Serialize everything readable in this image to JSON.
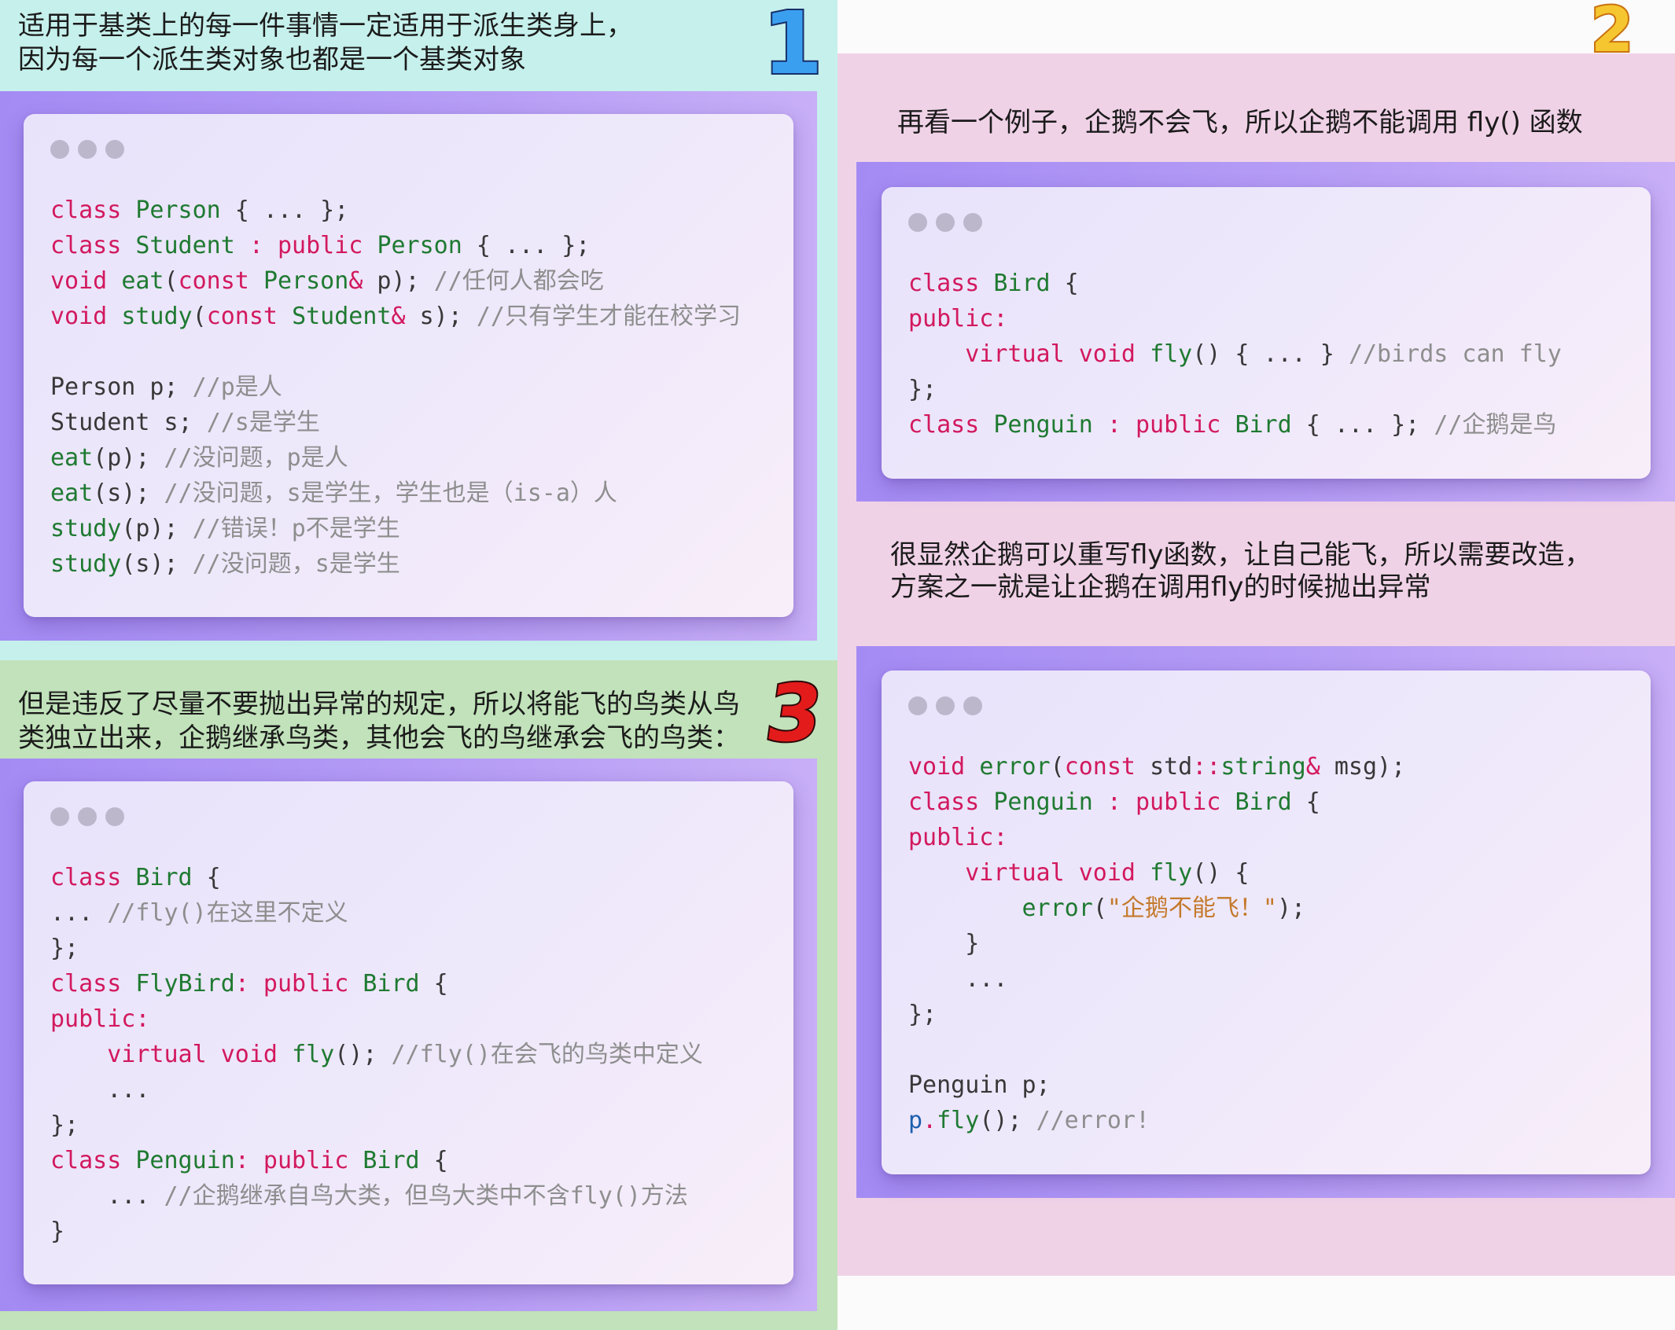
{
  "section_1": {
    "badge": "1",
    "caption": [
      "适用于基类上的每一件事情一定适用于派生类身上，",
      "因为每一个派生类对象也都是一个基类对象"
    ]
  },
  "section_2": {
    "badge": "2",
    "caption_top": "再看一个例子，企鹅不会飞，所以企鹅不能调用 fly() 函数",
    "caption_middle": [
      "很显然企鹅可以重写fly函数，让自己能飞，所以需要改造，",
      "方案之一就是让企鹅在调用fly的时候抛出异常"
    ]
  },
  "section_3": {
    "badge": "3",
    "caption": [
      "但是违反了尽量不要抛出异常的规定，所以将能飞的鸟类从鸟",
      "类独立出来，企鹅继承鸟类，其他会飞的鸟继承会飞的鸟类："
    ]
  },
  "colors": {
    "section_1_bg": "#c6f0ec",
    "section_2_bg": "#f0d2e7",
    "section_3_bg": "#c1e2ba",
    "outer_bg": "#fbfbfb",
    "stage_gradient": [
      "#a48bf4",
      "#c8aff7"
    ],
    "window_dot": "#bdb7cc"
  },
  "code_blocks": [
    {
      "lines": [
        [
          [
            "class ",
            "#d2195e"
          ],
          [
            "Person",
            "#1f7a31"
          ],
          [
            " { ... };",
            "#383838"
          ]
        ],
        [
          [
            "class ",
            "#d2195e"
          ],
          [
            "Student",
            "#1f7a31"
          ],
          [
            " : public ",
            "#d2195e"
          ],
          [
            "Person",
            "#1f7a31"
          ],
          [
            " { ... };",
            "#383838"
          ]
        ],
        [
          [
            "void ",
            "#d2195e"
          ],
          [
            "eat",
            "#1f7a31"
          ],
          [
            "(",
            "#383838"
          ],
          [
            "const ",
            "#d2195e"
          ],
          [
            "Person",
            "#1f7a31"
          ],
          [
            "&",
            "#d2195e"
          ],
          [
            " p); ",
            "#383838"
          ],
          [
            "//任何人都会吃",
            "#8e8e8e"
          ]
        ],
        [
          [
            "void ",
            "#d2195e"
          ],
          [
            "study",
            "#1f7a31"
          ],
          [
            "(",
            "#383838"
          ],
          [
            "const ",
            "#d2195e"
          ],
          [
            "Student",
            "#1f7a31"
          ],
          [
            "&",
            "#d2195e"
          ],
          [
            " s); ",
            "#383838"
          ],
          [
            "//只有学生才能在校学习",
            "#8e8e8e"
          ]
        ],
        [],
        [
          [
            "Person p; ",
            "#383838"
          ],
          [
            "//p是人",
            "#8e8e8e"
          ]
        ],
        [
          [
            "Student s; ",
            "#383838"
          ],
          [
            "//s是学生",
            "#8e8e8e"
          ]
        ],
        [
          [
            "eat",
            "#1f7a31"
          ],
          [
            "(p); ",
            "#383838"
          ],
          [
            "//没问题，p是人",
            "#8e8e8e"
          ]
        ],
        [
          [
            "eat",
            "#1f7a31"
          ],
          [
            "(s); ",
            "#383838"
          ],
          [
            "//没问题，s是学生，学生也是（is-a）人",
            "#8e8e8e"
          ]
        ],
        [
          [
            "study",
            "#1f7a31"
          ],
          [
            "(p); ",
            "#383838"
          ],
          [
            "//错误！p不是学生",
            "#8e8e8e"
          ]
        ],
        [
          [
            "study",
            "#1f7a31"
          ],
          [
            "(s); ",
            "#383838"
          ],
          [
            "//没问题，s是学生",
            "#8e8e8e"
          ]
        ]
      ]
    },
    {
      "lines": [
        [
          [
            "class ",
            "#d2195e"
          ],
          [
            "Bird",
            "#1f7a31"
          ],
          [
            " {",
            "#383838"
          ]
        ],
        [
          [
            "public:",
            "#d2195e"
          ]
        ],
        [
          [
            "    ",
            "#383838"
          ],
          [
            "virtual void ",
            "#d2195e"
          ],
          [
            "fly",
            "#1f7a31"
          ],
          [
            "() { ... } ",
            "#383838"
          ],
          [
            "//birds can fly",
            "#8e8e8e"
          ]
        ],
        [
          [
            "};",
            "#383838"
          ]
        ],
        [
          [
            "class ",
            "#d2195e"
          ],
          [
            "Penguin",
            "#1f7a31"
          ],
          [
            " : public ",
            "#d2195e"
          ],
          [
            "Bird",
            "#1f7a31"
          ],
          [
            " { ... }; ",
            "#383838"
          ],
          [
            "//企鹅是鸟",
            "#8e8e8e"
          ]
        ]
      ]
    },
    {
      "lines": [
        [
          [
            "void ",
            "#d2195e"
          ],
          [
            "error",
            "#1f7a31"
          ],
          [
            "(",
            "#383838"
          ],
          [
            "const ",
            "#d2195e"
          ],
          [
            "std",
            "#383838"
          ],
          [
            "::",
            "#d2195e"
          ],
          [
            "string",
            "#1f7a31"
          ],
          [
            "&",
            "#d2195e"
          ],
          [
            " msg);",
            "#383838"
          ]
        ],
        [
          [
            "class ",
            "#d2195e"
          ],
          [
            "Penguin",
            "#1f7a31"
          ],
          [
            " : public ",
            "#d2195e"
          ],
          [
            "Bird",
            "#1f7a31"
          ],
          [
            " {",
            "#383838"
          ]
        ],
        [
          [
            "public:",
            "#d2195e"
          ]
        ],
        [
          [
            "    ",
            "#383838"
          ],
          [
            "virtual void ",
            "#d2195e"
          ],
          [
            "fly",
            "#1f7a31"
          ],
          [
            "() {",
            "#383838"
          ]
        ],
        [
          [
            "        ",
            "#383838"
          ],
          [
            "error",
            "#1f7a31"
          ],
          [
            "(",
            "#383838"
          ],
          [
            "\"企鹅不能飞！\"",
            "#c47a2b"
          ],
          [
            ");",
            "#383838"
          ]
        ],
        [
          [
            "    }",
            "#383838"
          ]
        ],
        [
          [
            "    ...",
            "#383838"
          ]
        ],
        [
          [
            "};",
            "#383838"
          ]
        ],
        [],
        [
          [
            "Penguin p;",
            "#383838"
          ]
        ],
        [
          [
            "p",
            "#1d5fae"
          ],
          [
            ".",
            "#d2195e"
          ],
          [
            "fly",
            "#1f7a31"
          ],
          [
            "(); ",
            "#383838"
          ],
          [
            "//error!",
            "#8e8e8e"
          ]
        ]
      ]
    },
    {
      "lines": [
        [
          [
            "class ",
            "#d2195e"
          ],
          [
            "Bird",
            "#1f7a31"
          ],
          [
            " {",
            "#383838"
          ]
        ],
        [
          [
            "... ",
            "#383838"
          ],
          [
            "//fly()在这里不定义",
            "#8e8e8e"
          ]
        ],
        [
          [
            "};",
            "#383838"
          ]
        ],
        [
          [
            "class ",
            "#d2195e"
          ],
          [
            "FlyBird",
            "#1f7a31"
          ],
          [
            ": public ",
            "#d2195e"
          ],
          [
            "Bird",
            "#1f7a31"
          ],
          [
            " {",
            "#383838"
          ]
        ],
        [
          [
            "public:",
            "#d2195e"
          ]
        ],
        [
          [
            "    ",
            "#383838"
          ],
          [
            "virtual void ",
            "#d2195e"
          ],
          [
            "fly",
            "#1f7a31"
          ],
          [
            "(); ",
            "#383838"
          ],
          [
            "//fly()在会飞的鸟类中定义",
            "#8e8e8e"
          ]
        ],
        [
          [
            "    ...",
            "#383838"
          ]
        ],
        [
          [
            "};",
            "#383838"
          ]
        ],
        [
          [
            "class ",
            "#d2195e"
          ],
          [
            "Penguin",
            "#1f7a31"
          ],
          [
            ": public ",
            "#d2195e"
          ],
          [
            "Bird",
            "#1f7a31"
          ],
          [
            " {",
            "#383838"
          ]
        ],
        [
          [
            "    ... ",
            "#383838"
          ],
          [
            "//企鹅继承自鸟大类，但鸟大类中不含fly()方法",
            "#8e8e8e"
          ]
        ],
        [
          [
            "}",
            "#383838"
          ]
        ]
      ]
    }
  ]
}
